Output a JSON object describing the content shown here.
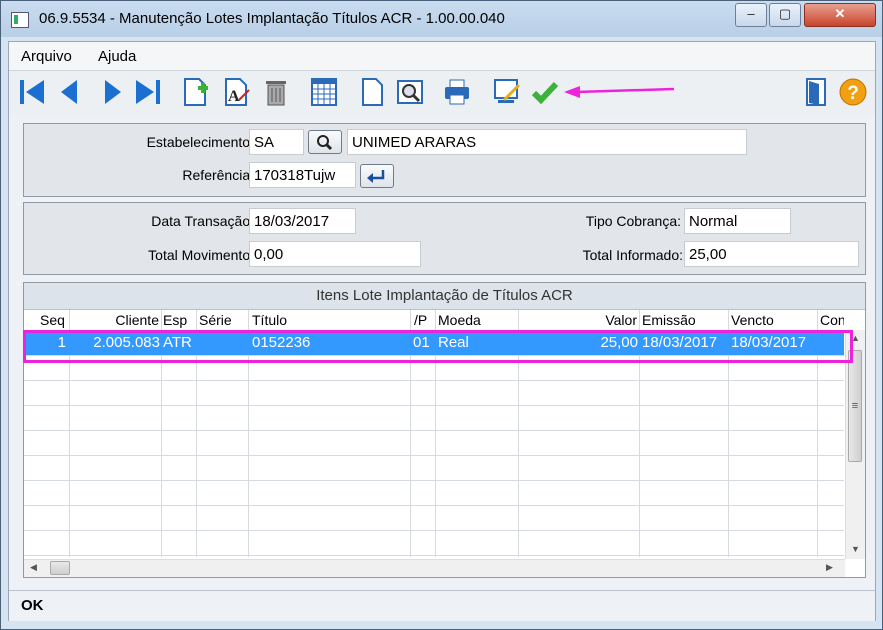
{
  "window": {
    "title": "06.9.5534 - Manutenção Lotes Implantação Títulos ACR - 1.00.00.040",
    "min_label": "‒",
    "max_label": "▢",
    "close_label": "✕"
  },
  "menu": {
    "file": "Arquivo",
    "help": "Ajuda"
  },
  "toolbar": {
    "icons": [
      "first-record-icon",
      "previous-record-icon",
      "next-record-icon",
      "last-record-icon",
      "new-record-icon",
      "edit-record-icon",
      "delete-icon",
      "table-view-icon",
      "document-icon",
      "print-preview-icon",
      "print-icon",
      "edit-settings-icon",
      "confirm-check-icon",
      "exit-door-icon",
      "help-icon"
    ],
    "help_label": "?"
  },
  "header": {
    "estabelecimento_label": "Estabelecimento:",
    "estabelecimento_value": "SA",
    "estabelecimento_name": "UNIMED ARARAS",
    "referencia_label": "Referência:",
    "referencia_value": "170318Tujw"
  },
  "totals": {
    "data_transacao_label": "Data Transação:",
    "data_transacao_value": "18/03/2017",
    "total_movimento_label": "Total Movimento:",
    "total_movimento_value": "0,00",
    "tipo_cobranca_label": "Tipo Cobrança:",
    "tipo_cobranca_value": "Normal",
    "total_informado_label": "Total Informado:",
    "total_informado_value": "25,00"
  },
  "grid": {
    "title": "Itens Lote Implantação de Títulos ACR",
    "columns": [
      "Seq",
      "Cliente",
      "Esp",
      "Série",
      "Título",
      "/P",
      "Moeda",
      "Valor",
      "Emissão",
      "Vencto",
      "Con"
    ],
    "rows": [
      {
        "seq": "1",
        "cliente": "2.005.083",
        "esp": "ATR",
        "serie": "",
        "titulo": "0152236",
        "parcela": "01",
        "moeda": "Real",
        "valor": "25,00",
        "emissao": "18/03/2017",
        "vencto": "18/03/2017",
        "con": ""
      }
    ]
  },
  "status": {
    "text": "OK"
  },
  "colors": {
    "selection": "#3399ff",
    "annotation": "#ee22dd"
  }
}
